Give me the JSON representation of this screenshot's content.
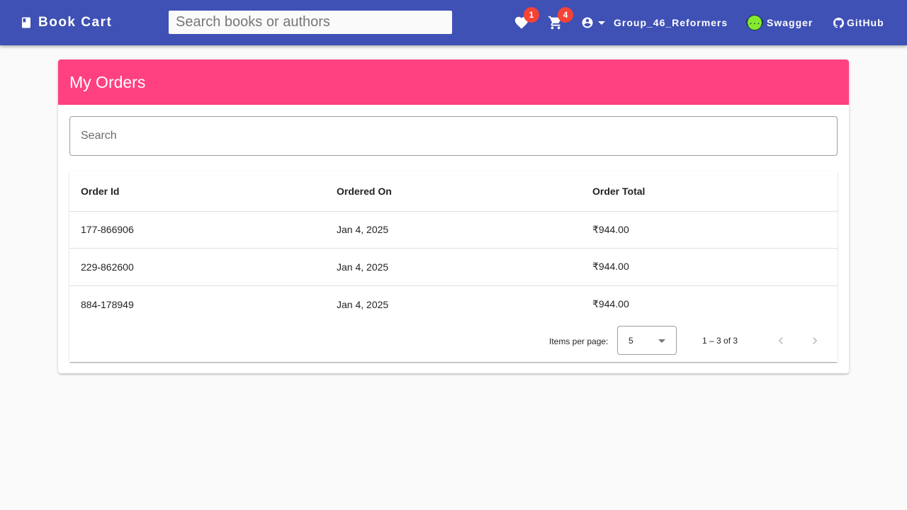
{
  "header": {
    "brand_icon": "book-icon",
    "title": "Book Cart",
    "search_placeholder": "Search books or authors",
    "wishlist": {
      "icon": "heart-icon",
      "count": "1"
    },
    "cart": {
      "icon": "cart-icon",
      "count": "4"
    },
    "user": {
      "icon": "account-circle-icon",
      "name": "Group_46_Reformers"
    },
    "swagger": {
      "icon": "swagger-icon",
      "logo_text": "{...}",
      "label": "Swagger"
    },
    "github": {
      "icon": "github-icon",
      "label": "GitHub"
    }
  },
  "colors": {
    "toolbar": "#3f51b5",
    "card_header": "#ff4081",
    "badge": "#f44336"
  },
  "orders": {
    "title": "My Orders",
    "search_placeholder": "Search",
    "columns": [
      "Order Id",
      "Ordered On",
      "Order Total"
    ],
    "rows": [
      {
        "id": "177-866906",
        "date": "Jan 4, 2025",
        "total": "₹944.00"
      },
      {
        "id": "229-862600",
        "date": "Jan 4, 2025",
        "total": "₹944.00"
      },
      {
        "id": "884-178949",
        "date": "Jan 4, 2025",
        "total": "₹944.00"
      }
    ],
    "paginator": {
      "items_per_page_label": "Items per page:",
      "page_size": "5",
      "range": "1 – 3 of 3",
      "prev_icon": "chevron-left-icon",
      "next_icon": "chevron-right-icon"
    }
  }
}
